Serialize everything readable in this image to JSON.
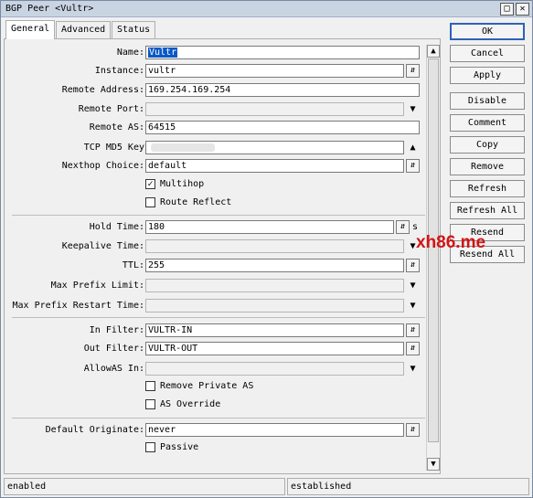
{
  "window": {
    "title": "BGP Peer <Vultr>",
    "restore_glyph": "□",
    "close_glyph": "✕"
  },
  "tabs": [
    {
      "label": "General"
    },
    {
      "label": "Advanced"
    },
    {
      "label": "Status"
    }
  ],
  "form": {
    "name": {
      "label": "Name:",
      "value": "Vultr"
    },
    "instance": {
      "label": "Instance:",
      "value": "vultr"
    },
    "remote_address": {
      "label": "Remote Address:",
      "value": "169.254.169.254"
    },
    "remote_port": {
      "label": "Remote Port:",
      "value": ""
    },
    "remote_as": {
      "label": "Remote AS:",
      "value": "64515"
    },
    "tcp_md5_key": {
      "label": "TCP MD5 Key",
      "value": ""
    },
    "nexthop_choice": {
      "label": "Nexthop Choice:",
      "value": "default"
    },
    "multihop": {
      "label": "Multihop",
      "checked": true
    },
    "route_reflect": {
      "label": "Route Reflect",
      "checked": false
    },
    "hold_time": {
      "label": "Hold Time:",
      "value": "180",
      "unit": "s"
    },
    "keepalive_time": {
      "label": "Keepalive Time:",
      "value": ""
    },
    "ttl": {
      "label": "TTL:",
      "value": "255"
    },
    "max_prefix_limit": {
      "label": "Max Prefix Limit:",
      "value": ""
    },
    "max_prefix_restart_time": {
      "label": "Max Prefix Restart Time:",
      "value": ""
    },
    "in_filter": {
      "label": "In Filter:",
      "value": "VULTR-IN"
    },
    "out_filter": {
      "label": "Out Filter:",
      "value": "VULTR-OUT"
    },
    "allowas_in": {
      "label": "AllowAS In:",
      "value": ""
    },
    "remove_private_as": {
      "label": "Remove Private AS",
      "checked": false
    },
    "as_override": {
      "label": "AS Override",
      "checked": false
    },
    "default_originate": {
      "label": "Default Originate:",
      "value": "never"
    },
    "passive": {
      "label": "Passive",
      "checked": false
    }
  },
  "buttons": {
    "ok": "OK",
    "cancel": "Cancel",
    "apply": "Apply",
    "disable": "Disable",
    "comment": "Comment",
    "copy": "Copy",
    "remove": "Remove",
    "refresh": "Refresh",
    "refresh_all": "Refresh All",
    "resend": "Resend",
    "resend_all": "Resend All"
  },
  "status_bar": {
    "left": "enabled",
    "right": "established"
  },
  "watermark": "xh86.me",
  "glyphs": {
    "updown": "⇵",
    "down": "▼",
    "up": "▲",
    "check": "✓",
    "scroll_up": "▲",
    "scroll_down": "▼"
  }
}
